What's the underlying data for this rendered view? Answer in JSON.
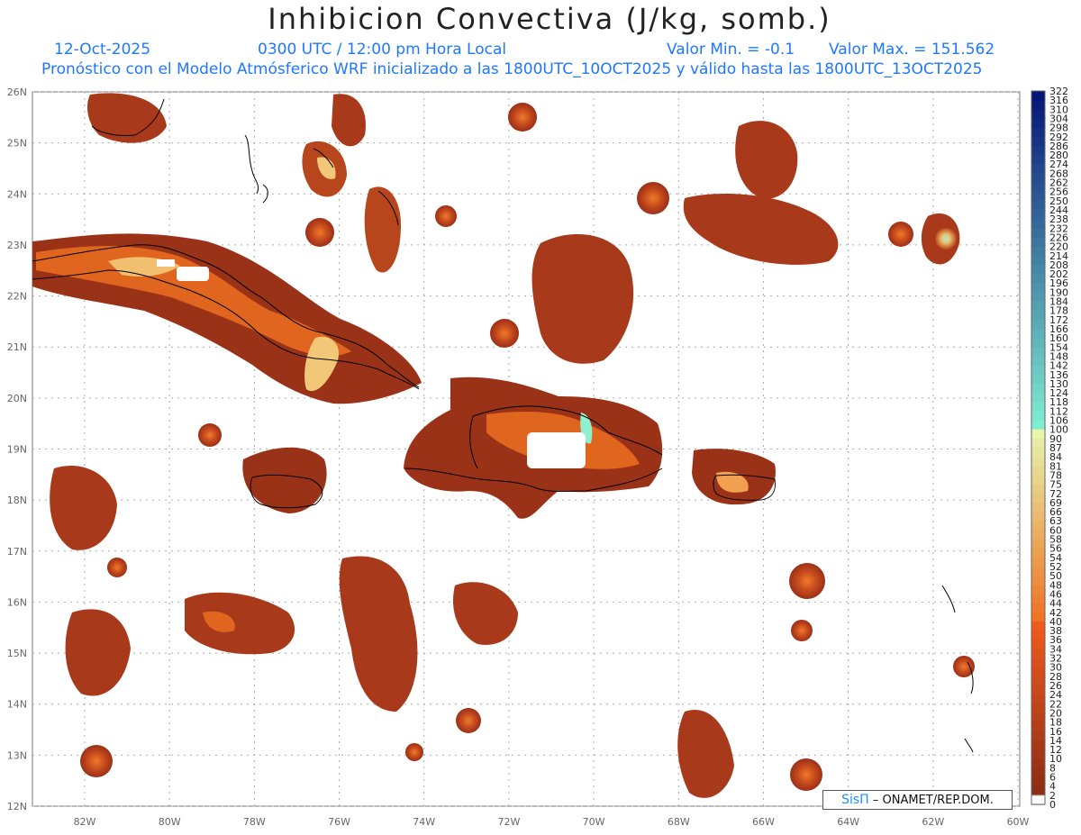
{
  "header": {
    "title": "Inhibicion Convectiva (J/kg, somb.)",
    "date": "12-Oct-2025",
    "time": "0300 UTC / 12:00 pm Hora Local",
    "vmin_label": "Valor Min. = -0.1",
    "vmax_label": "Valor Max. = 151.562",
    "model_line": "Pronóstico con el Modelo Atmósferico WRF inicializado a las 1800UTC_10OCT2025 y válido hasta las  1800UTC_13OCT2025"
  },
  "map": {
    "lon_range": [
      -83,
      -60
    ],
    "lat_range": [
      12,
      26
    ],
    "lat_ticks": [
      "26N",
      "25N",
      "24N",
      "23N",
      "22N",
      "21N",
      "20N",
      "19N",
      "18N",
      "17N",
      "16N",
      "15N",
      "14N",
      "13N",
      "12N"
    ],
    "lon_ticks": [
      "82W",
      "80W",
      "78W",
      "76W",
      "74W",
      "72W",
      "70W",
      "68W",
      "66W",
      "64W",
      "62W",
      "60W"
    ],
    "gridlines": true,
    "colors": {
      "grid": "#aaaaaa",
      "coast": "#000000",
      "shade_low": "#8a2a17",
      "shade_mid": "#e8661e",
      "shade_high": "#8ff0d0"
    }
  },
  "colorbar": {
    "labels": [
      "322",
      "316",
      "310",
      "304",
      "298",
      "292",
      "286",
      "280",
      "274",
      "268",
      "262",
      "256",
      "250",
      "244",
      "238",
      "232",
      "226",
      "220",
      "214",
      "208",
      "202",
      "196",
      "190",
      "184",
      "178",
      "172",
      "166",
      "160",
      "154",
      "148",
      "142",
      "136",
      "130",
      "124",
      "118",
      "112",
      "106",
      "100",
      "90",
      "87",
      "84",
      "81",
      "78",
      "75",
      "72",
      "69",
      "66",
      "63",
      "60",
      "58",
      "56",
      "54",
      "52",
      "50",
      "48",
      "46",
      "44",
      "42",
      "40",
      "38",
      "36",
      "34",
      "32",
      "30",
      "28",
      "26",
      "24",
      "22",
      "20",
      "18",
      "16",
      "14",
      "12",
      "10",
      "8",
      "6",
      "4",
      "2",
      "0"
    ]
  },
  "credit": {
    "brand": "SisΠ",
    "text": "– ONAMET/REP.DOM."
  }
}
